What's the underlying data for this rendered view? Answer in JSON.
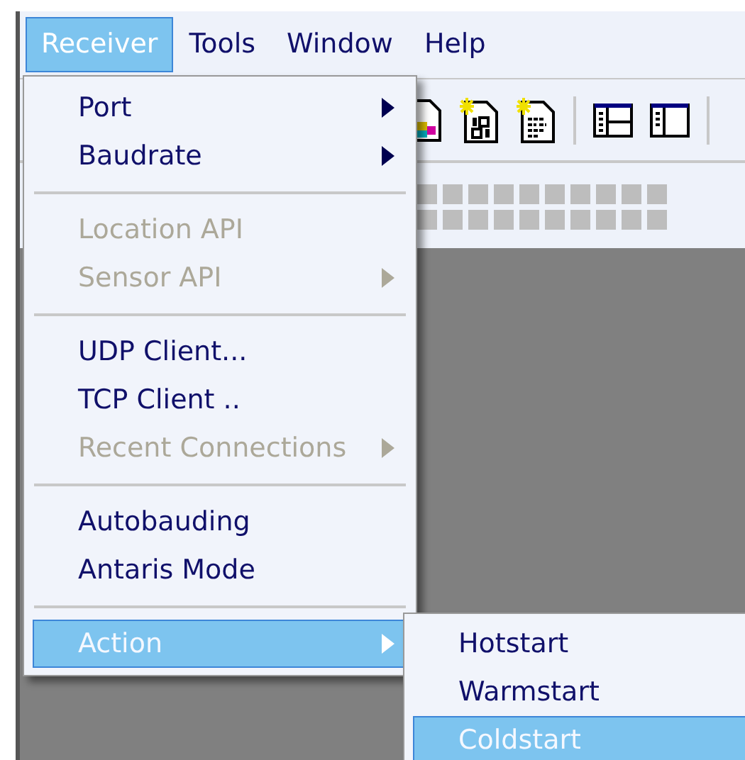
{
  "menubar": [
    {
      "label": "Receiver",
      "selected": true
    },
    {
      "label": "Tools",
      "selected": false
    },
    {
      "label": "Window",
      "selected": false
    },
    {
      "label": "Help",
      "selected": false
    }
  ],
  "menu": [
    {
      "kind": "item",
      "label": "Port",
      "disabled": false,
      "submenu": true,
      "selected": false
    },
    {
      "kind": "item",
      "label": "Baudrate",
      "disabled": false,
      "submenu": true,
      "selected": false
    },
    {
      "kind": "separator"
    },
    {
      "kind": "item",
      "label": "Location API",
      "disabled": true,
      "submenu": false,
      "selected": false
    },
    {
      "kind": "item",
      "label": "Sensor API",
      "disabled": true,
      "submenu": true,
      "selected": false
    },
    {
      "kind": "separator"
    },
    {
      "kind": "item",
      "label": "UDP Client...",
      "disabled": false,
      "submenu": false,
      "selected": false
    },
    {
      "kind": "item",
      "label": "TCP Client ..",
      "disabled": false,
      "submenu": false,
      "selected": false
    },
    {
      "kind": "item",
      "label": "Recent Connections",
      "disabled": true,
      "submenu": true,
      "selected": false
    },
    {
      "kind": "separator"
    },
    {
      "kind": "item",
      "label": "Autobauding",
      "disabled": false,
      "submenu": false,
      "selected": false
    },
    {
      "kind": "item",
      "label": "Antaris Mode",
      "disabled": false,
      "submenu": false,
      "selected": false
    },
    {
      "kind": "separator"
    },
    {
      "kind": "item",
      "label": "Action",
      "disabled": false,
      "submenu": true,
      "selected": true
    }
  ],
  "submenu": [
    {
      "label": "Hotstart",
      "selected": false
    },
    {
      "label": "Warmstart",
      "selected": false
    },
    {
      "label": "Coldstart",
      "selected": true
    }
  ]
}
